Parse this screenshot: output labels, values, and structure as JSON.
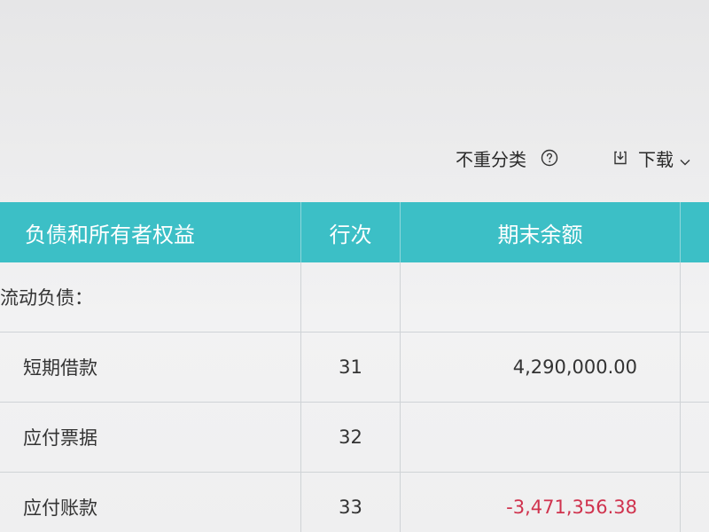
{
  "toolbar": {
    "classify_label": "不重分类",
    "help_icon": "help-circle-icon",
    "download_label": "下载",
    "download_icon": "download-icon",
    "chevron_icon": "chevron-down-icon"
  },
  "table": {
    "headers": {
      "name": "负债和所有者权益",
      "line": "行次",
      "amount": "期末余额"
    },
    "rows": [
      {
        "name": "流动负债：",
        "line": "",
        "amount": ""
      },
      {
        "name": "短期借款",
        "line": "31",
        "amount": "4,290,000.00"
      },
      {
        "name": "应付票据",
        "line": "32",
        "amount": ""
      },
      {
        "name": "应付账款",
        "line": "33",
        "amount": "-3,471,356.38"
      }
    ]
  },
  "colors": {
    "header_bg": "#3cbfc6",
    "negative": "#d0334e"
  }
}
